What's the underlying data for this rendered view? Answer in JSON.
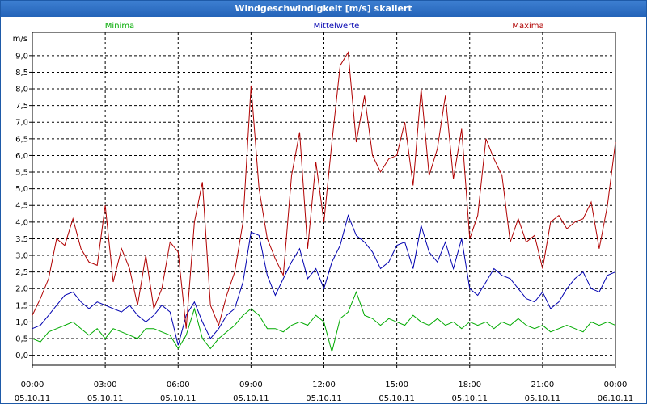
{
  "window": {
    "title": "Windgeschwindigkeit [m/s] skaliert"
  },
  "chart_data": {
    "type": "line",
    "title": "Windgeschwindigkeit [m/s] skaliert",
    "ylabel": "m/s",
    "xlabel": "",
    "ylim": [
      -0.3,
      9.7
    ],
    "xlim": [
      0,
      24
    ],
    "grid": true,
    "legend": "top",
    "y_ticks": [
      "0,0",
      "0,5",
      "1,0",
      "1,5",
      "2,0",
      "2,5",
      "3,0",
      "3,5",
      "4,0",
      "4,5",
      "5,0",
      "5,5",
      "6,0",
      "6,5",
      "7,0",
      "7,5",
      "8,0",
      "8,5",
      "9,0"
    ],
    "x_ticks": [
      {
        "time": "00:00",
        "date": "05.10.11"
      },
      {
        "time": "03:00",
        "date": "05.10.11"
      },
      {
        "time": "06:00",
        "date": "05.10.11"
      },
      {
        "time": "09:00",
        "date": "05.10.11"
      },
      {
        "time": "12:00",
        "date": "05.10.11"
      },
      {
        "time": "15:00",
        "date": "05.10.11"
      },
      {
        "time": "18:00",
        "date": "05.10.11"
      },
      {
        "time": "21:00",
        "date": "05.10.11"
      },
      {
        "time": "00:00",
        "date": "06.10.11"
      }
    ],
    "series": [
      {
        "name": "Minima",
        "color": "#00aa00",
        "x": [
          0,
          0.33,
          0.67,
          1,
          1.33,
          1.67,
          2,
          2.33,
          2.67,
          3,
          3.33,
          3.67,
          4,
          4.33,
          4.67,
          5,
          5.33,
          5.67,
          6,
          6.33,
          6.67,
          7,
          7.33,
          7.67,
          8,
          8.33,
          8.67,
          9,
          9.33,
          9.67,
          10,
          10.33,
          10.67,
          11,
          11.33,
          11.67,
          12,
          12.33,
          12.67,
          13,
          13.33,
          13.67,
          14,
          14.33,
          14.67,
          15,
          15.33,
          15.67,
          16,
          16.33,
          16.67,
          17,
          17.33,
          17.67,
          18,
          18.33,
          18.67,
          19,
          19.33,
          19.67,
          20,
          20.33,
          20.67,
          21,
          21.33,
          21.67,
          22,
          22.33,
          22.67,
          23,
          23.33,
          23.67,
          24
        ],
        "y": [
          0.5,
          0.4,
          0.7,
          0.8,
          0.9,
          1.0,
          0.8,
          0.6,
          0.8,
          0.5,
          0.8,
          0.7,
          0.6,
          0.5,
          0.8,
          0.8,
          0.7,
          0.6,
          0.2,
          0.6,
          1.4,
          0.5,
          0.2,
          0.5,
          0.7,
          0.9,
          1.2,
          1.4,
          1.2,
          0.8,
          0.8,
          0.7,
          0.9,
          1.0,
          0.9,
          1.2,
          1.0,
          0.1,
          1.1,
          1.3,
          1.9,
          1.2,
          1.1,
          0.9,
          1.1,
          1.0,
          0.9,
          1.2,
          1.0,
          0.9,
          1.1,
          0.9,
          1.0,
          0.8,
          1.0,
          0.9,
          1.0,
          0.8,
          1.0,
          0.9,
          1.1,
          0.9,
          0.8,
          0.9,
          0.7,
          0.8,
          0.9,
          0.8,
          0.7,
          1.0,
          0.9,
          1.0,
          0.9
        ]
      },
      {
        "name": "Mittelwerte",
        "color": "#0000b0",
        "x": [
          0,
          0.33,
          0.67,
          1,
          1.33,
          1.67,
          2,
          2.33,
          2.67,
          3,
          3.33,
          3.67,
          4,
          4.33,
          4.67,
          5,
          5.33,
          5.67,
          6,
          6.33,
          6.67,
          7,
          7.33,
          7.67,
          8,
          8.33,
          8.67,
          9,
          9.33,
          9.67,
          10,
          10.33,
          10.67,
          11,
          11.33,
          11.67,
          12,
          12.33,
          12.67,
          13,
          13.33,
          13.67,
          14,
          14.33,
          14.67,
          15,
          15.33,
          15.67,
          16,
          16.33,
          16.67,
          17,
          17.33,
          17.67,
          18,
          18.33,
          18.67,
          19,
          19.33,
          19.67,
          20,
          20.33,
          20.67,
          21,
          21.33,
          21.67,
          22,
          22.33,
          22.67,
          23,
          23.33,
          23.67,
          24
        ],
        "y": [
          0.8,
          0.9,
          1.2,
          1.5,
          1.8,
          1.9,
          1.6,
          1.4,
          1.6,
          1.5,
          1.4,
          1.3,
          1.5,
          1.2,
          1.0,
          1.2,
          1.5,
          1.3,
          0.3,
          1.2,
          1.6,
          1.0,
          0.5,
          0.8,
          1.2,
          1.4,
          2.2,
          3.7,
          3.6,
          2.4,
          1.8,
          2.3,
          2.8,
          3.2,
          2.3,
          2.6,
          2.0,
          2.8,
          3.3,
          4.2,
          3.6,
          3.4,
          3.1,
          2.6,
          2.8,
          3.3,
          3.4,
          2.6,
          3.9,
          3.1,
          2.8,
          3.4,
          2.6,
          3.5,
          2.0,
          1.8,
          2.2,
          2.6,
          2.4,
          2.3,
          2.0,
          1.7,
          1.6,
          1.9,
          1.4,
          1.6,
          2.0,
          2.3,
          2.5,
          2.0,
          1.9,
          2.4,
          2.5
        ]
      },
      {
        "name": "Maxima",
        "color": "#b00000",
        "x": [
          0,
          0.33,
          0.67,
          1,
          1.33,
          1.67,
          2,
          2.33,
          2.67,
          3,
          3.33,
          3.67,
          4,
          4.33,
          4.67,
          5,
          5.33,
          5.67,
          6,
          6.33,
          6.67,
          7,
          7.33,
          7.67,
          8,
          8.33,
          8.67,
          9,
          9.33,
          9.67,
          10,
          10.33,
          10.67,
          11,
          11.33,
          11.67,
          12,
          12.33,
          12.67,
          13,
          13.33,
          13.67,
          14,
          14.33,
          14.67,
          15,
          15.33,
          15.67,
          16,
          16.33,
          16.67,
          17,
          17.33,
          17.67,
          18,
          18.33,
          18.67,
          19,
          19.33,
          19.67,
          20,
          20.33,
          20.67,
          21,
          21.33,
          21.67,
          22,
          22.33,
          22.67,
          23,
          23.33,
          23.67,
          24
        ],
        "y": [
          1.2,
          1.7,
          2.3,
          3.5,
          3.3,
          4.1,
          3.2,
          2.8,
          2.7,
          4.5,
          2.2,
          3.2,
          2.6,
          1.5,
          3.0,
          1.4,
          2.0,
          3.4,
          3.1,
          0.8,
          4.0,
          5.2,
          1.5,
          0.9,
          1.8,
          2.5,
          4.0,
          8.1,
          5.0,
          3.5,
          2.9,
          2.4,
          5.4,
          6.7,
          3.2,
          5.8,
          4.0,
          6.4,
          8.7,
          9.1,
          6.4,
          7.8,
          6.0,
          5.5,
          5.9,
          6.0,
          7.0,
          5.1,
          8.0,
          5.4,
          6.2,
          7.8,
          5.3,
          6.8,
          3.5,
          4.2,
          6.5,
          5.9,
          5.4,
          3.4,
          4.1,
          3.4,
          3.6,
          2.6,
          4.0,
          4.2,
          3.8,
          4.0,
          4.1,
          4.6,
          3.2,
          4.5,
          6.4
        ]
      }
    ]
  }
}
